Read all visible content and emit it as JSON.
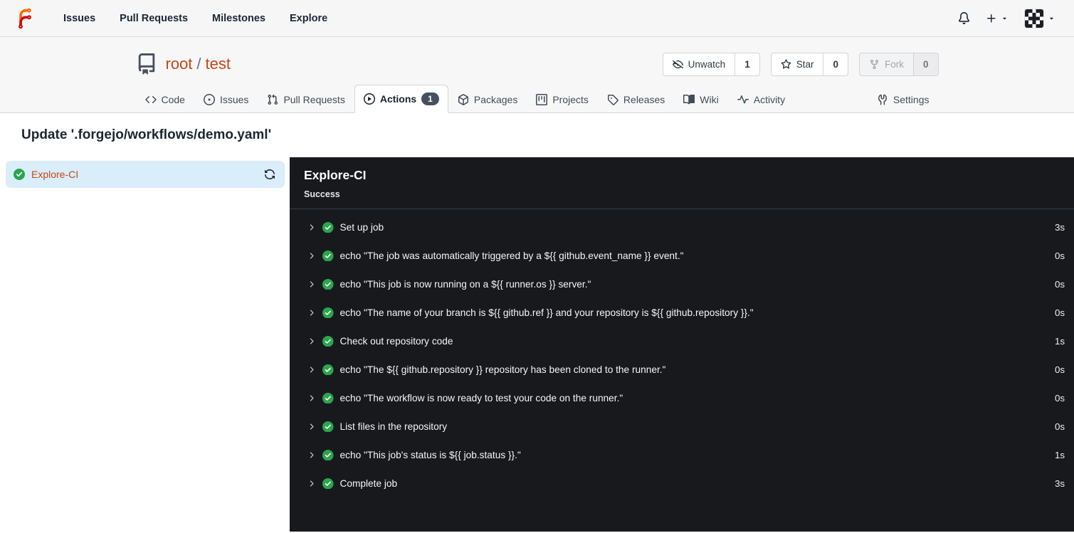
{
  "navbar": {
    "items": [
      "Issues",
      "Pull Requests",
      "Milestones",
      "Explore"
    ]
  },
  "repo": {
    "owner": "root",
    "separator": "/",
    "name": "test",
    "buttons": {
      "unwatch": {
        "label": "Unwatch",
        "count": "1"
      },
      "star": {
        "label": "Star",
        "count": "0"
      },
      "fork": {
        "label": "Fork",
        "count": "0"
      }
    }
  },
  "tabs": {
    "items": [
      {
        "label": "Code"
      },
      {
        "label": "Issues"
      },
      {
        "label": "Pull Requests"
      },
      {
        "label": "Actions",
        "badge": "1"
      },
      {
        "label": "Packages"
      },
      {
        "label": "Projects"
      },
      {
        "label": "Releases"
      },
      {
        "label": "Wiki"
      },
      {
        "label": "Activity"
      },
      {
        "label": "Settings"
      }
    ]
  },
  "run": {
    "title": "Update '.forgejo/workflows/demo.yaml'"
  },
  "jobs": {
    "items": [
      {
        "name": "Explore-CI",
        "status": "success"
      }
    ]
  },
  "panel": {
    "title": "Explore-CI",
    "status": "Success",
    "steps": [
      {
        "name": "Set up job",
        "duration": "3s"
      },
      {
        "name": "echo \"The job was automatically triggered by a ${{ github.event_name }} event.\"",
        "duration": "0s"
      },
      {
        "name": "echo \"This job is now running on a ${{ runner.os }} server.\"",
        "duration": "0s"
      },
      {
        "name": "echo \"The name of your branch is ${{ github.ref }} and your repository is ${{ github.repository }}.\"",
        "duration": "0s"
      },
      {
        "name": "Check out repository code",
        "duration": "1s"
      },
      {
        "name": "echo \"The ${{ github.repository }} repository has been cloned to the runner.\"",
        "duration": "0s"
      },
      {
        "name": "echo \"The workflow is now ready to test your code on the runner.\"",
        "duration": "0s"
      },
      {
        "name": "List files in the repository",
        "duration": "0s"
      },
      {
        "name": "echo \"This job's status is ${{ job.status }}.\"",
        "duration": "1s"
      },
      {
        "name": "Complete job",
        "duration": "3s"
      }
    ]
  },
  "colors": {
    "accent_orange": "#c64614",
    "success_green": "#2da44e",
    "panel_background": "#17191d",
    "selected_job_background": "#d9edfa",
    "logo_orange": "#ff6600",
    "logo_red": "#d40000"
  }
}
